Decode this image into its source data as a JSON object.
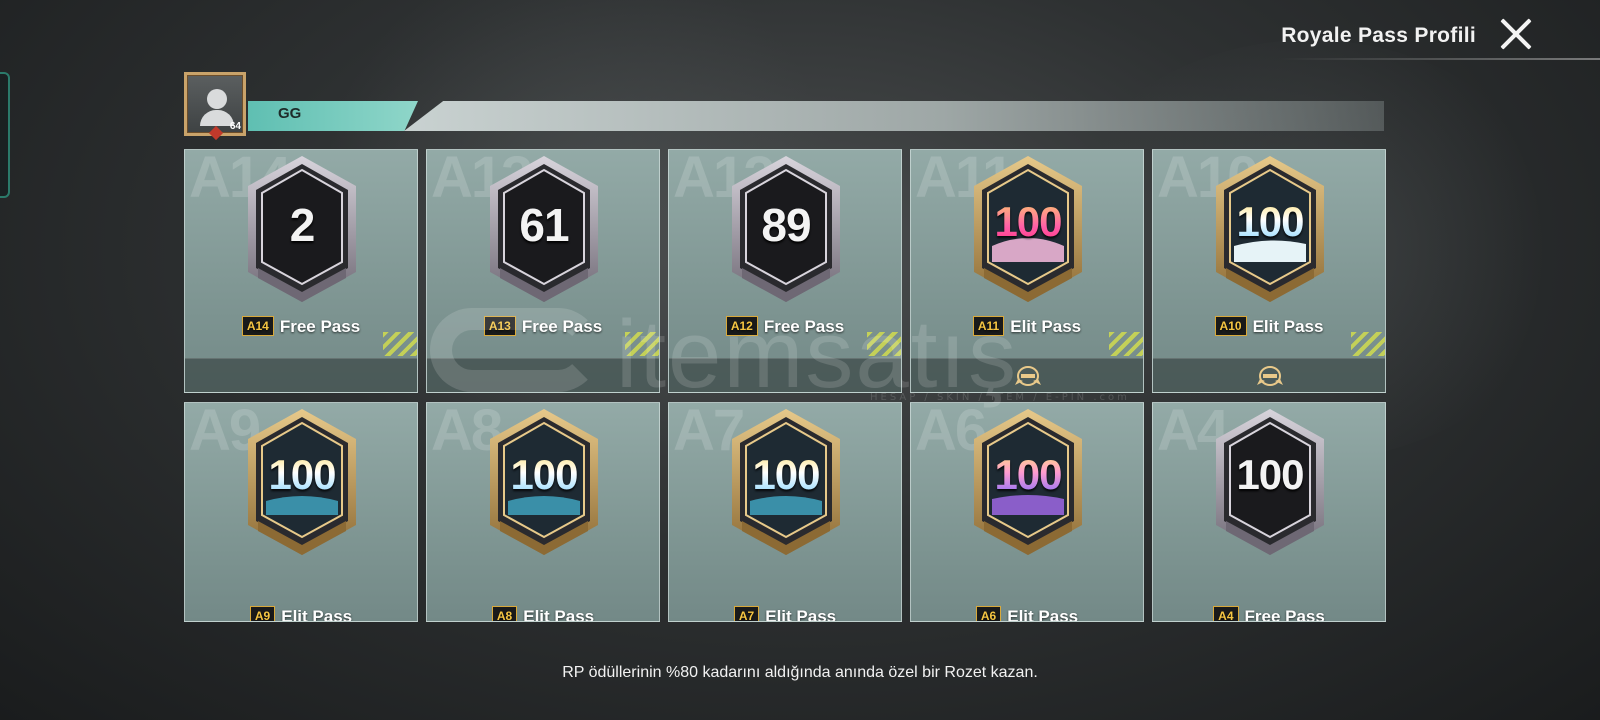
{
  "header": {
    "title": "Royale Pass Profili"
  },
  "profile": {
    "name": "GG",
    "level": "64"
  },
  "cards": [
    {
      "season_bg": "A14",
      "value": "2",
      "season": "A14",
      "pass": "Free Pass",
      "style": "silver"
    },
    {
      "season_bg": "A13",
      "value": "61",
      "season": "A13",
      "pass": "Free Pass",
      "style": "silver"
    },
    {
      "season_bg": "A12",
      "value": "89",
      "season": "A12",
      "pass": "Free Pass",
      "style": "silver"
    },
    {
      "season_bg": "A11",
      "value": "100",
      "season": "A11",
      "pass": "Elit Pass",
      "style": "gold-pink"
    },
    {
      "season_bg": "A10",
      "value": "100",
      "season": "A10",
      "pass": "Elit Pass",
      "style": "gold-snow"
    },
    {
      "season_bg": "A9",
      "value": "100",
      "season": "A9",
      "pass": "Elit Pass",
      "style": "gold"
    },
    {
      "season_bg": "A8",
      "value": "100",
      "season": "A8",
      "pass": "Elit Pass",
      "style": "gold"
    },
    {
      "season_bg": "A7",
      "value": "100",
      "season": "A7",
      "pass": "Elit Pass",
      "style": "gold"
    },
    {
      "season_bg": "A6",
      "value": "100",
      "season": "A6",
      "pass": "Elit Pass",
      "style": "gold-purple"
    },
    {
      "season_bg": "A4",
      "value": "100",
      "season": "A4",
      "pass": "Free Pass",
      "style": "silver"
    }
  ],
  "footer_text": "RP ödüllerinin %80 kadarını aldığında anında özel bir Rozet kazan.",
  "watermark": {
    "brand": "itemsatış",
    "tagline": "HESAP / SKIN / ITEM / E-PIN .com"
  },
  "colors": {
    "accent_teal": "#5fbfb2",
    "card_bg": "#87a09d",
    "gold": "#c9a36a",
    "tag_text": "#f5c542"
  },
  "icons": {
    "close": "close-icon",
    "avatar": "user-avatar-icon",
    "crest": "elite-crest-icon"
  }
}
